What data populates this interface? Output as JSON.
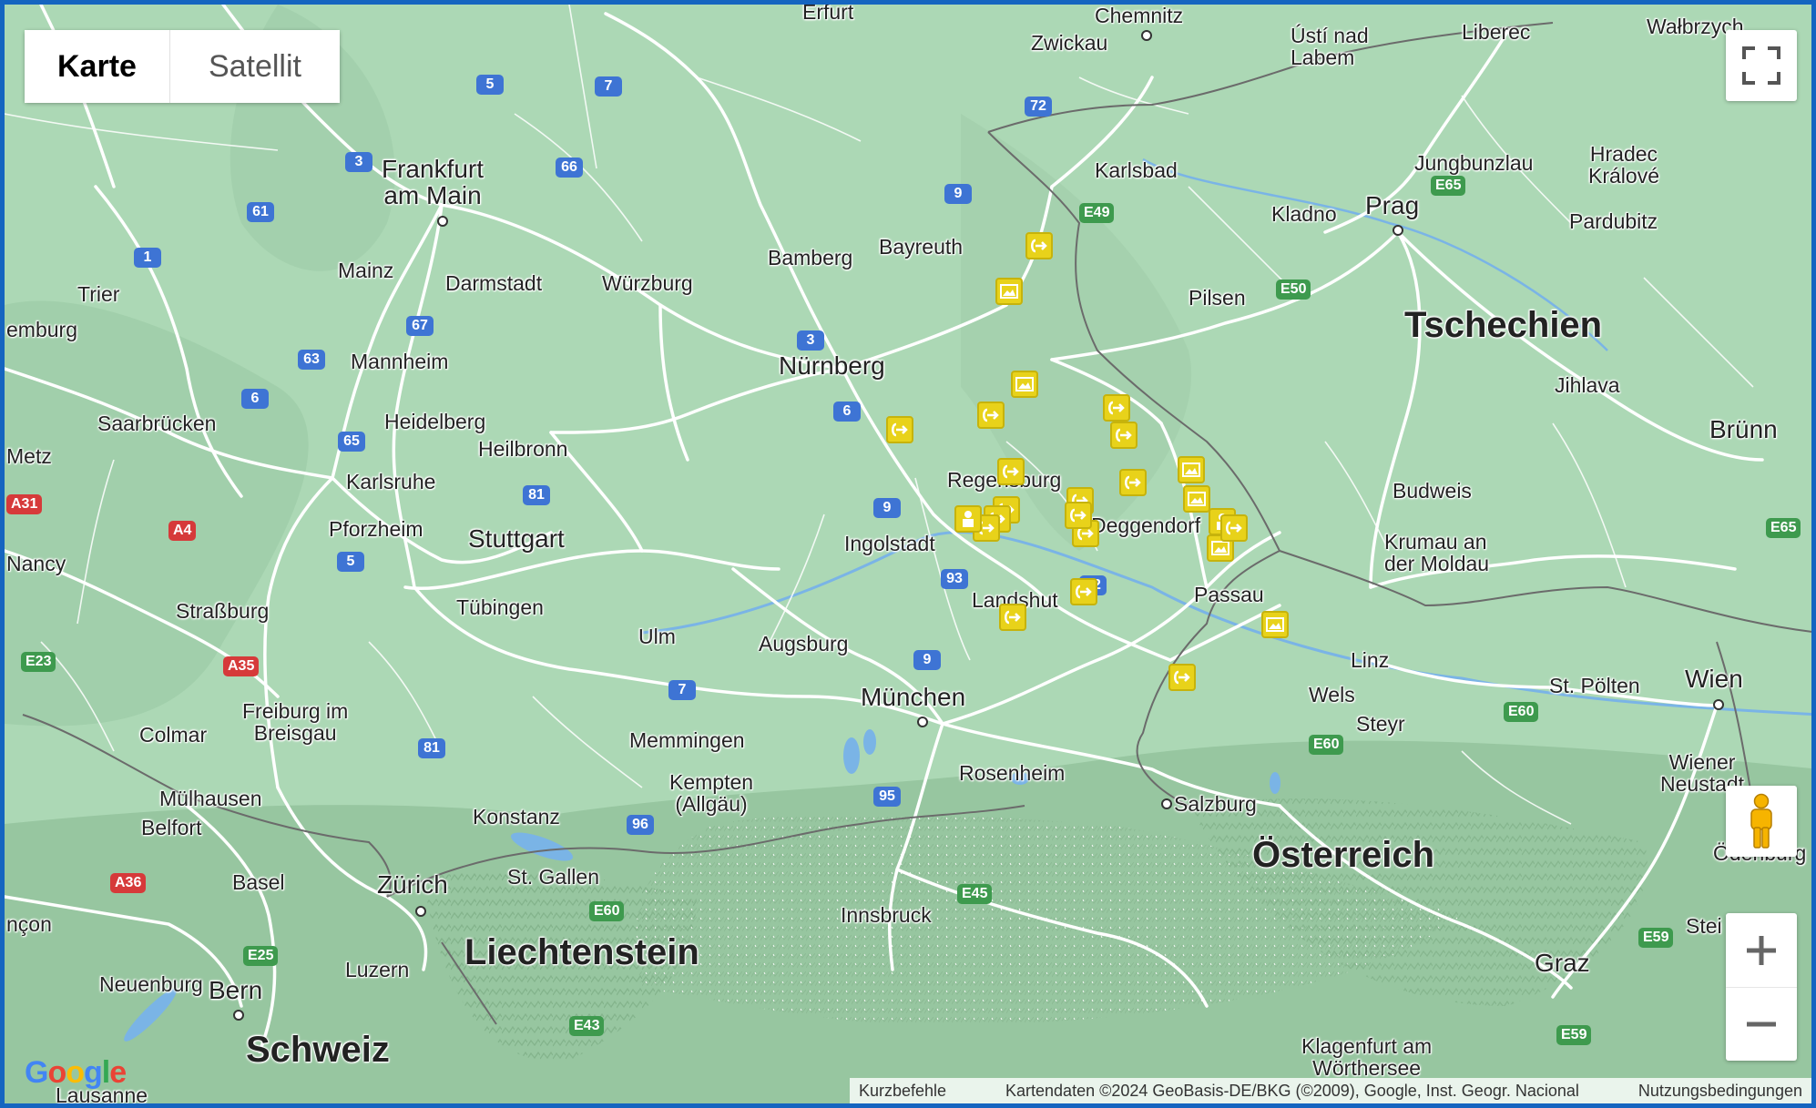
{
  "map_type": {
    "map_label": "Karte",
    "satellite_label": "Satellit"
  },
  "countries": [
    {
      "id": "cz",
      "name": "Tschechien"
    },
    {
      "id": "at",
      "name": "Österreich"
    },
    {
      "id": "li",
      "name": "Liechtenstein"
    },
    {
      "id": "ch",
      "name": "Schweiz"
    }
  ],
  "places": {
    "erfurt": "Erfurt",
    "chemnitz": "Chemnitz",
    "zwickau": "Zwickau",
    "usti": "Ústí nad\nLabem",
    "liberec": "Liberec",
    "walbrzych": "Wałbrzych",
    "frankfurt": "Frankfurt\nam Main",
    "karlsbad": "Karlsbad",
    "jungbunzlau": "Jungbunzlau",
    "hradec": "Hradec\nKrálové",
    "prag": "Prag",
    "kladno": "Kladno",
    "pardubitz": "Pardubitz",
    "mainz": "Mainz",
    "darmstadt": "Darmstadt",
    "wurzburg": "Würzburg",
    "bamberg": "Bamberg",
    "bayreuth": "Bayreuth",
    "trier": "Trier",
    "luxemburg": "emburg",
    "pilsen": "Pilsen",
    "mannheim": "Mannheim",
    "heidelberg": "Heidelberg",
    "nurnberg": "Nürnberg",
    "jihlava": "Jihlava",
    "saarbrucken": "Saarbrücken",
    "brunn": "Brünn",
    "metz": "Metz",
    "heilbronn": "Heilbronn",
    "karlsruhe": "Karlsruhe",
    "regensburg": "Regensburg",
    "budweis": "Budweis",
    "pforzheim": "Pforzheim",
    "stuttgart": "Stuttgart",
    "ingolstadt": "Ingolstadt",
    "deggendorf": "Deggendorf",
    "krumau": "Krumau an\nder Moldau",
    "nancy": "Nancy",
    "strassburg": "Straßburg",
    "tubingen": "Tübingen",
    "landshut": "Landshut",
    "passau": "Passau",
    "ulm": "Ulm",
    "augsburg": "Augsburg",
    "linz": "Linz",
    "stpolten": "St. Pölten",
    "wien": "Wien",
    "wels": "Wels",
    "munchen": "München",
    "freiburg": "Freiburg im\nBreisgau",
    "colmar": "Colmar",
    "steyr": "Steyr",
    "memmingen": "Memmingen",
    "kempten": "Kempten\n(Allgäu)",
    "rosenheim": "Rosenheim",
    "wienerneustadt": "Wiener\nNeustadt",
    "mulhausen": "Mülhausen",
    "salzburg": "Salzburg",
    "konstanz": "Konstanz",
    "belfort": "Belfort",
    "basel": "Basel",
    "zurich": "Zürich",
    "stgallen": "St. Gallen",
    "innsbruck": "Innsbruck",
    "odenburg": "Ödenburg",
    "besancon": "nçon",
    "steiermark": "Stei",
    "luzern": "Luzern",
    "graz": "Graz",
    "neuenburg": "Neuenburg",
    "bern": "Bern",
    "klagenfurt": "Klagenfurt am\nWörthersee",
    "lausanne": "Lausanne"
  },
  "roads": [
    "5",
    "7",
    "72",
    "3",
    "66",
    "9",
    "61",
    "1",
    "67",
    "63",
    "6",
    "65",
    "81",
    "5",
    "93",
    "92",
    "9",
    "7",
    "95",
    "96",
    "81",
    "E49",
    "E50",
    "E65",
    "E23",
    "A35",
    "A36",
    "E25",
    "E43",
    "E60",
    "E45",
    "E60",
    "E60",
    "E59",
    "E59",
    "A31",
    "A4",
    "E65",
    "3",
    "6",
    "9"
  ],
  "markers": [
    "arrow",
    "photo",
    "photo",
    "arrow",
    "arrow",
    "arrow",
    "arrow",
    "arrow",
    "arrow",
    "arrow",
    "arrow",
    "arrow",
    "photo",
    "photo",
    "arrow",
    "person",
    "arrow",
    "arrow",
    "person",
    "photo",
    "arrow",
    "arrow",
    "photo",
    "arrow",
    "arrow"
  ],
  "footer": {
    "shortcuts": "Kurzbefehle",
    "attribution": "Kartendaten ©2024 GeoBasis-DE/BKG (©2009), Google, Inst. Geogr. Nacional",
    "terms": "Nutzungsbedingungen"
  },
  "logo": "Google",
  "colors": {
    "land": "#aed9b7",
    "mountains": "#9fcaa6",
    "road": "#ffffff",
    "border": "#6b6b6b",
    "marker": "#e8d21a",
    "frame": "#1565c0"
  }
}
